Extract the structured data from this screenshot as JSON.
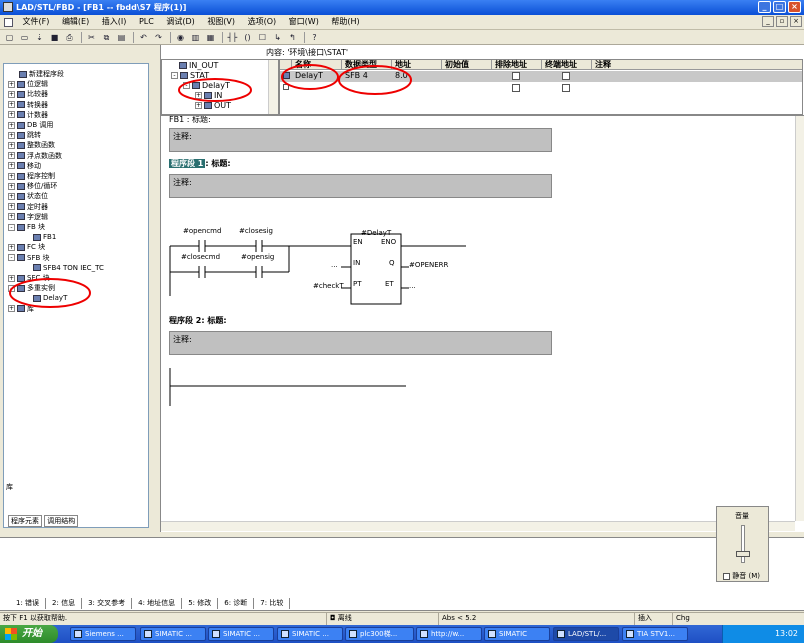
{
  "window": {
    "title": "LAD/STL/FBD  - [FB1 -- fbdd\\S7 程序(1)]",
    "min": "_",
    "max": "□",
    "close": "×"
  },
  "menu": [
    "文件(F)",
    "编辑(E)",
    "插入(I)",
    "PLC",
    "调试(D)",
    "视图(V)",
    "选项(O)",
    "窗口(W)",
    "帮助(H)"
  ],
  "toolbar_icons": [
    "new-icon",
    "open-icon",
    "download-icon",
    "save-icon",
    "print-icon",
    "cut-icon",
    "copy-icon",
    "paste-icon",
    "undo-icon",
    "redo-icon",
    "monitor-icon",
    "overview-icon",
    "network-icon",
    "contact-icon",
    "coil-icon",
    "box-icon",
    "branch-icon",
    "close-branch-icon",
    "help-icon"
  ],
  "left_tree": [
    {
      "label": "新建程序段",
      "indent": 0,
      "expand": ""
    },
    {
      "label": "位逻辑",
      "indent": 0,
      "expand": "+"
    },
    {
      "label": "比较器",
      "indent": 0,
      "expand": "+"
    },
    {
      "label": "转换器",
      "indent": 0,
      "expand": "+"
    },
    {
      "label": "计数器",
      "indent": 0,
      "expand": "+"
    },
    {
      "label": "DB 调用",
      "indent": 0,
      "expand": "+"
    },
    {
      "label": "跳转",
      "indent": 0,
      "expand": "+"
    },
    {
      "label": "整数函数",
      "indent": 0,
      "expand": "+"
    },
    {
      "label": "浮点数函数",
      "indent": 0,
      "expand": "+"
    },
    {
      "label": "移动",
      "indent": 0,
      "expand": "+"
    },
    {
      "label": "程序控制",
      "indent": 0,
      "expand": "+"
    },
    {
      "label": "移位/循环",
      "indent": 0,
      "expand": "+"
    },
    {
      "label": "状态位",
      "indent": 0,
      "expand": "+"
    },
    {
      "label": "定时器",
      "indent": 0,
      "expand": "+"
    },
    {
      "label": "字逻辑",
      "indent": 0,
      "expand": "+"
    },
    {
      "label": "FB 块",
      "indent": 0,
      "expand": "-"
    },
    {
      "label": "FB1",
      "indent": 1,
      "expand": ""
    },
    {
      "label": "FC 块",
      "indent": 0,
      "expand": "+"
    },
    {
      "label": "SFB 块",
      "indent": 0,
      "expand": "-"
    },
    {
      "label": "SFB4    TON    IEC_TC",
      "indent": 1,
      "expand": ""
    },
    {
      "label": "SFC 块",
      "indent": 0,
      "expand": "+"
    },
    {
      "label": "多重实例",
      "indent": 0,
      "expand": "-"
    },
    {
      "label": "DelayT",
      "indent": 1,
      "expand": ""
    },
    {
      "label": "库",
      "indent": 0,
      "expand": "+"
    }
  ],
  "left_footer_label": "库",
  "left_tabs": [
    "程序元素",
    "调用结构"
  ],
  "interface": {
    "content_label": "内容: '环境\\接口\\STAT'",
    "tree": [
      "IN_OUT",
      "STAT",
      "DelayT",
      "IN",
      "OUT"
    ],
    "columns": [
      "名称",
      "数据类型",
      "地址",
      "初始值",
      "排除地址",
      "终端地址",
      "注释"
    ],
    "row": {
      "name": "DelayT",
      "type": "SFB 4",
      "address": "8.0",
      "initial": "",
      "comment": ""
    }
  },
  "editor": {
    "fb_title": "FB1 : 标题:",
    "comment_label": "注释:",
    "segment1_label": "程序段 1",
    "segment1_title": ": 标题:",
    "segment1_comment": "注释:",
    "contacts": [
      "#opencmd",
      "#closesig",
      "#closecmd",
      "#opensig"
    ],
    "box": {
      "name": "#DelayT",
      "en": "EN",
      "eno": "ENO",
      "in": "IN",
      "q": "Q",
      "pt": "PT",
      "et": "ET",
      "q_out": "#OPENERR",
      "pt_in": "#checkT",
      "in_dots": "...",
      "et_dots": "..."
    },
    "segment2_label": "程序段 2",
    "segment2_title": ": 标题:",
    "segment2_comment": "注释:"
  },
  "bottom_tabs": [
    "1: 错误",
    "2: 信息",
    "3: 交叉参考",
    "4: 地址信息",
    "5: 修改",
    "6: 诊断",
    "7: 比较"
  ],
  "status": {
    "help": "按下 F1 以获取帮助.",
    "mode": "离线",
    "abs": "Abs < 5.2",
    "insert": "插入",
    "chg": "Chg"
  },
  "volume": {
    "title": "音量",
    "mute": "静音 (M)"
  },
  "taskbar": {
    "start": "开始",
    "tasks": [
      "Siemens ...",
      "SIMATIC ...",
      "SIMATIC ...",
      "SIMATIC ...",
      "plc300梯...",
      "http://w...",
      "SIMATIC",
      "LAD/STL/...",
      "TIA STV1..."
    ],
    "clock": "13:02"
  }
}
